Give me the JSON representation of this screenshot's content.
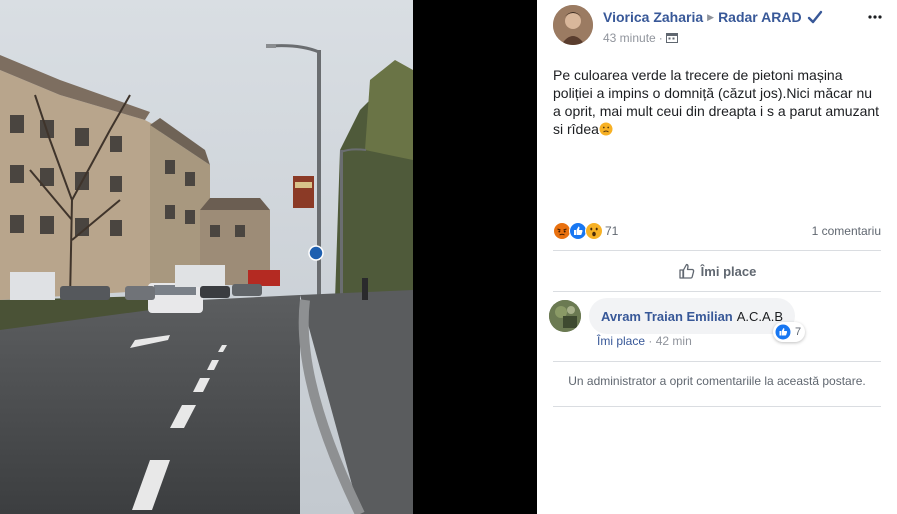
{
  "post": {
    "author": "Viorica Zaharia",
    "group": "Radar ARAD",
    "time": "43 minute",
    "text": "Pe culoarea verde la trecere de pietoni mașina poliției a impins o domniță (căzut jos).Nici măcar nu a oprit, mai mult ceui din dreapta i s a parut amuzant si rîdea",
    "icons": {
      "audience": "calendar-icon",
      "verified": "verified-badge-icon",
      "more": "more-options-icon",
      "inline_emoji": "worried-face-emoji-icon"
    }
  },
  "reactions": {
    "types": [
      "angry",
      "like",
      "wow"
    ],
    "count": "71",
    "comments_count": "1 comentariu"
  },
  "actions": {
    "like_label": "Îmi place"
  },
  "comment": {
    "author": "Avram Traian Emilian",
    "text": "A.C.A.B",
    "like_link": "Îmi place",
    "separator": "·",
    "time": "42 min",
    "reaction_count": "7"
  },
  "notice": "Un administrator a oprit comentariile la această postare.",
  "colors": {
    "link": "#385898",
    "secondary": "#90949c",
    "divider": "#dadde1",
    "bubble": "#f2f3f5",
    "like_blue": "#1877f2",
    "angry": "#e9710f",
    "wow": "#f7b125"
  }
}
